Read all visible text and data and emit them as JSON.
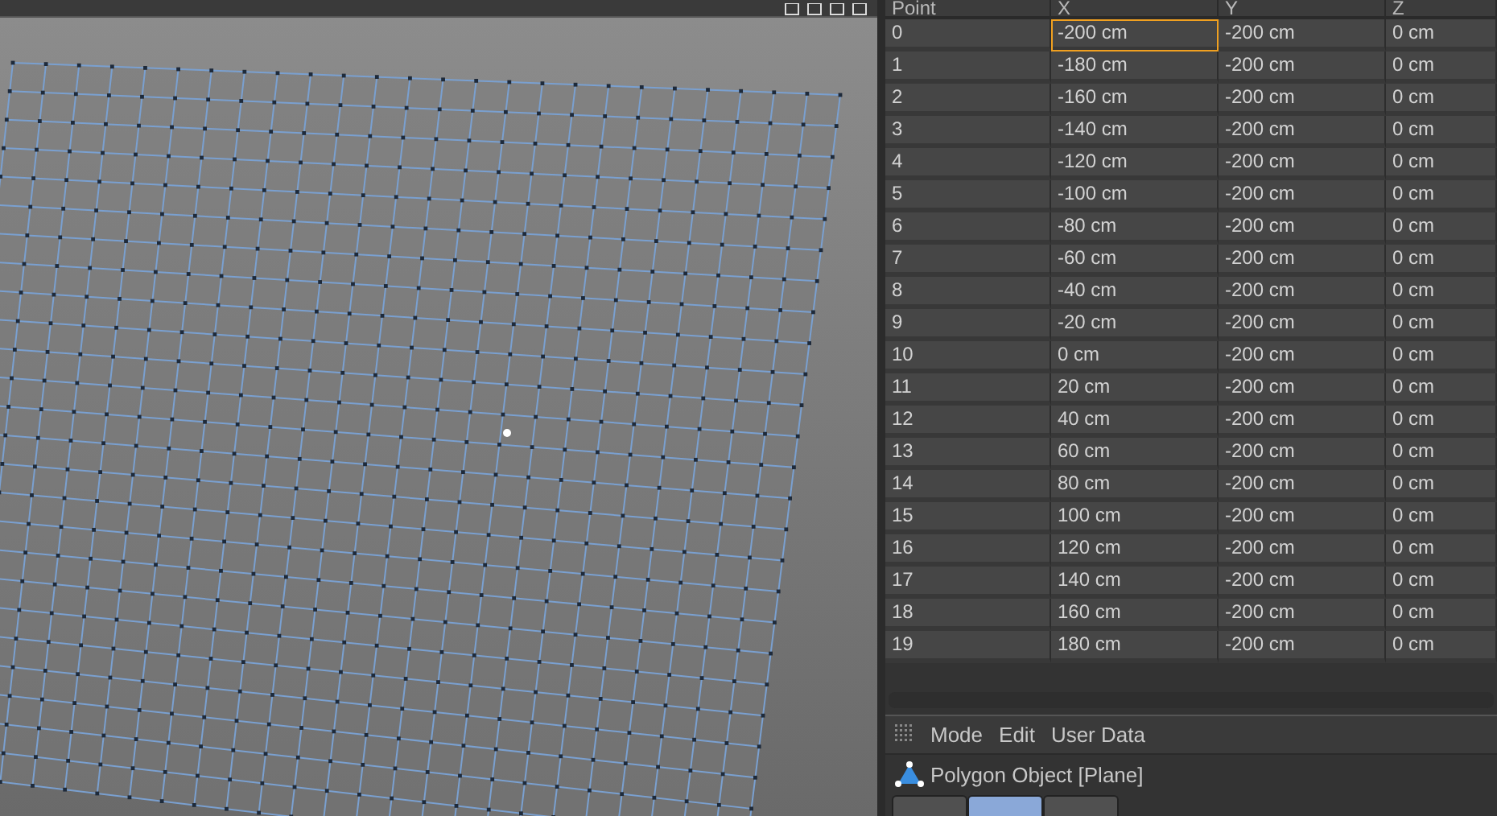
{
  "table": {
    "columns": [
      "Point",
      "X",
      "Y",
      "Z"
    ],
    "rows": [
      {
        "cells": [
          "0",
          "-200 cm",
          "-200 cm",
          "0 cm"
        ],
        "selected": true
      },
      {
        "cells": [
          "1",
          "-180 cm",
          "-200 cm",
          "0 cm"
        ],
        "selected": false
      },
      {
        "cells": [
          "2",
          "-160 cm",
          "-200 cm",
          "0 cm"
        ],
        "selected": false
      },
      {
        "cells": [
          "3",
          "-140 cm",
          "-200 cm",
          "0 cm"
        ],
        "selected": false
      },
      {
        "cells": [
          "4",
          "-120 cm",
          "-200 cm",
          "0 cm"
        ],
        "selected": false
      },
      {
        "cells": [
          "5",
          "-100 cm",
          "-200 cm",
          "0 cm"
        ],
        "selected": false
      },
      {
        "cells": [
          "6",
          "-80 cm",
          "-200 cm",
          "0 cm"
        ],
        "selected": false
      },
      {
        "cells": [
          "7",
          "-60 cm",
          "-200 cm",
          "0 cm"
        ],
        "selected": false
      },
      {
        "cells": [
          "8",
          "-40 cm",
          "-200 cm",
          "0 cm"
        ],
        "selected": false
      },
      {
        "cells": [
          "9",
          "-20 cm",
          "-200 cm",
          "0 cm"
        ],
        "selected": false
      },
      {
        "cells": [
          "10",
          "0 cm",
          "-200 cm",
          "0 cm"
        ],
        "selected": false
      },
      {
        "cells": [
          "11",
          "20 cm",
          "-200 cm",
          "0 cm"
        ],
        "selected": false
      },
      {
        "cells": [
          "12",
          "40 cm",
          "-200 cm",
          "0 cm"
        ],
        "selected": false
      },
      {
        "cells": [
          "13",
          "60 cm",
          "-200 cm",
          "0 cm"
        ],
        "selected": false
      },
      {
        "cells": [
          "14",
          "80 cm",
          "-200 cm",
          "0 cm"
        ],
        "selected": false
      },
      {
        "cells": [
          "15",
          "100 cm",
          "-200 cm",
          "0 cm"
        ],
        "selected": false
      },
      {
        "cells": [
          "16",
          "120 cm",
          "-200 cm",
          "0 cm"
        ],
        "selected": false
      },
      {
        "cells": [
          "17",
          "140 cm",
          "-200 cm",
          "0 cm"
        ],
        "selected": false
      },
      {
        "cells": [
          "18",
          "160 cm",
          "-200 cm",
          "0 cm"
        ],
        "selected": false
      },
      {
        "cells": [
          "19",
          "180 cm",
          "-200 cm",
          "0 cm"
        ],
        "selected": false
      }
    ]
  },
  "attributes": {
    "menu": [
      "Mode",
      "Edit",
      "User Data"
    ],
    "title": "Polygon Object [Plane]",
    "tabs": [
      {
        "selected": false
      },
      {
        "selected": true
      },
      {
        "selected": false
      }
    ]
  }
}
